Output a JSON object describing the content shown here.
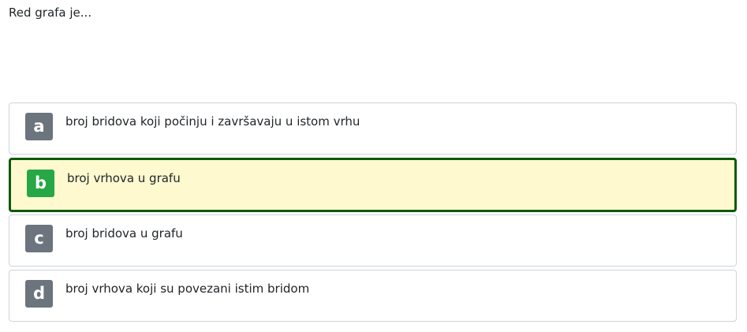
{
  "question": {
    "text": "Red grafa je..."
  },
  "options": [
    {
      "letter": "a",
      "text": "broj bridova koji počinju i završavaju u istom vrhu",
      "selected": false
    },
    {
      "letter": "b",
      "text": "broj vrhova u grafu",
      "selected": true
    },
    {
      "letter": "c",
      "text": "broj bridova u grafu",
      "selected": false
    },
    {
      "letter": "d",
      "text": "broj vrhova koji su povezani istim bridom",
      "selected": false
    }
  ],
  "colors": {
    "badge_default": "#6c757d",
    "badge_selected": "#28a745",
    "selected_background": "#fff9cf",
    "selected_border": "#0b5a0b"
  }
}
